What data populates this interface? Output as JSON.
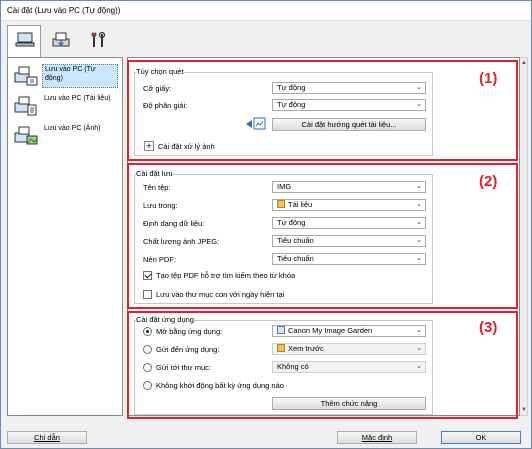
{
  "window": {
    "title": "Cài đặt (Lưu vào PC (Tự động))"
  },
  "tabs": [
    {
      "icon": "computer-icon"
    },
    {
      "icon": "scanner-icon"
    },
    {
      "icon": "tools-icon"
    }
  ],
  "sidebar": {
    "items": [
      {
        "label": "Lưu vào PC (Tự động)",
        "icon": "auto-scan-icon",
        "selected": true
      },
      {
        "label": "Lưu vào PC (Tài liệu)",
        "icon": "document-scan-icon",
        "selected": false
      },
      {
        "label": "Lưu vào PC (Ảnh)",
        "icon": "photo-scan-icon",
        "selected": false
      }
    ]
  },
  "callouts": [
    "(1)",
    "(2)",
    "(3)"
  ],
  "scan_options": {
    "title": "Tùy chọn quét",
    "paper_label": "Cỡ giấy:",
    "paper_value": "Tự động",
    "resolution_label": "Độ phân giải:",
    "resolution_value": "Tự động",
    "doc_scan_button": "Cài đặt hướng quét tài liệu...",
    "image_processing_label": "Cài đặt xử lý ảnh"
  },
  "save_settings": {
    "title": "Cài đặt lưu",
    "filename_label": "Tên tệp:",
    "filename_value": "IMG",
    "save_in_label": "Lưu trong:",
    "save_in_value": "Tài liệu",
    "format_label": "Định dạng dữ liệu:",
    "format_value": "Tự động",
    "jpeg_label": "Chất lượng ảnh JPEG:",
    "jpeg_value": "Tiêu chuẩn",
    "pdf_label": "Nén PDF:",
    "pdf_value": "Tiêu chuẩn",
    "keyword_pdf_label": "Tạo tệp PDF hỗ trợ tìm kiếm theo từ khóa",
    "keyword_pdf_checked": true,
    "subfolder_label": "Lưu vào thư mục con với ngày hiện tại",
    "subfolder_checked": false
  },
  "app_settings": {
    "title": "Cài đặt ứng dụng",
    "open_with_label": "Mở bằng ứng dụng:",
    "open_with_value": "Canon My Image Garden",
    "send_app_label": "Gửi đến ứng dụng:",
    "send_app_value": "Xem trước",
    "send_folder_label": "Gửi tới thư mục:",
    "send_folder_value": "Không có",
    "no_app_label": "Không khởi động bất kỳ ứng dụng nào",
    "add_button": "Thêm chức năng",
    "selected_option": "open_with"
  },
  "footer": {
    "help_button": "Chỉ dẫn",
    "defaults_button": "Mặc định",
    "ok_button": "OK"
  },
  "colors": {
    "callout_red": "#e5202e",
    "selection": "#cce8ff"
  }
}
